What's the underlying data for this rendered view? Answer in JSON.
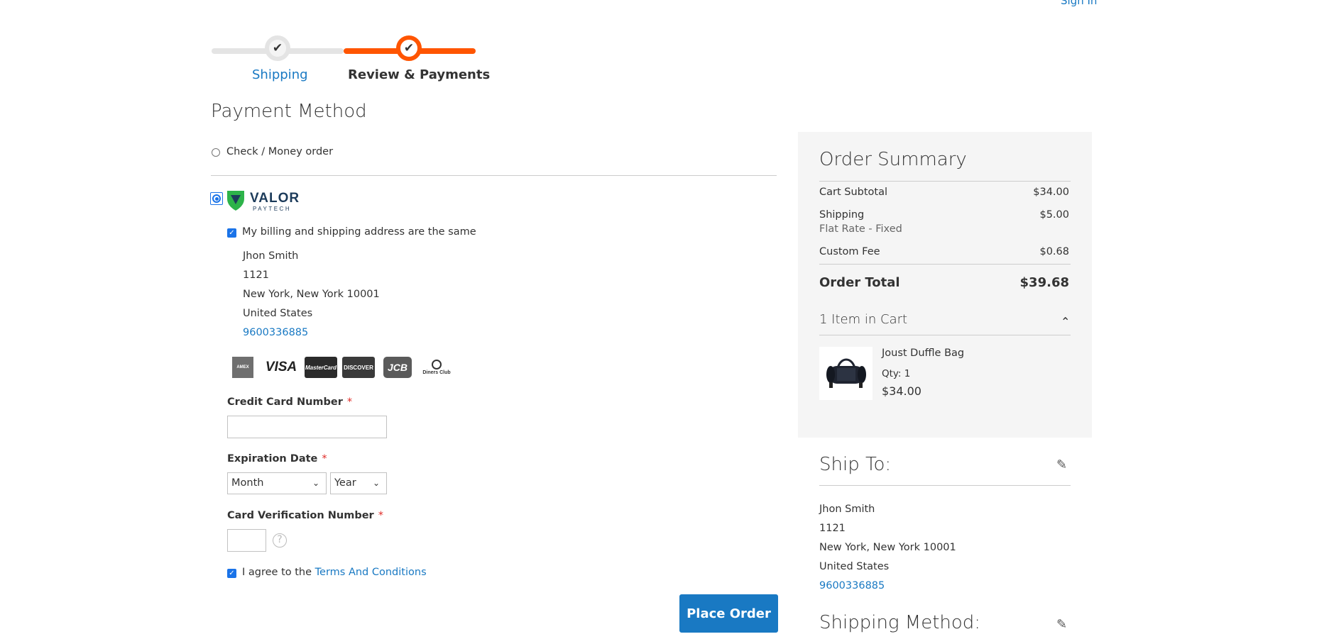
{
  "header": {
    "sign_in": "Sign In"
  },
  "progress": {
    "steps": [
      {
        "label": "Shipping",
        "state": "complete"
      },
      {
        "label": "Review & Payments",
        "state": "active"
      }
    ],
    "check_glyph": "✔"
  },
  "payment": {
    "title": "Payment Method",
    "methods": [
      {
        "label": "Check / Money order",
        "selected": false
      },
      {
        "label": "Valor PayTech",
        "selected": true
      }
    ],
    "valor_logo": {
      "word": "VALOR",
      "sub": "PAYTECH",
      "colors": {
        "green": "#2db34a",
        "navy": "#1c3b5a"
      }
    },
    "billing_same_label": "My billing and shipping address are the same",
    "address": {
      "name": "Jhon Smith",
      "street": "1121",
      "city": "New York, New York 10001",
      "country": "United States",
      "phone": "9600336885"
    },
    "cards": [
      "AMEX",
      "VISA",
      "MasterCard",
      "DISCOVER",
      "JCB",
      "Diners Club"
    ],
    "cc_number": {
      "label": "Credit Card Number",
      "required": "*",
      "value": ""
    },
    "expiration": {
      "label": "Expiration Date",
      "required": "*",
      "month": "Month",
      "year": "Year"
    },
    "cvv": {
      "label": "Card Verification Number",
      "required": "*",
      "help": "?"
    },
    "terms": {
      "prefix": "I agree to the ",
      "link": "Terms And Conditions",
      "checked": true
    },
    "place_order": "Place Order"
  },
  "summary": {
    "title": "Order Summary",
    "rows": [
      {
        "label": "Cart Subtotal",
        "value": "$34.00"
      },
      {
        "label": "Shipping",
        "sub": "Flat Rate - Fixed",
        "value": "$5.00"
      },
      {
        "label": "Custom Fee",
        "value": "$0.68"
      }
    ],
    "total": {
      "label": "Order Total",
      "value": "$39.68"
    },
    "items_heading": "1 Item in Cart",
    "item": {
      "name": "Joust Duffle Bag",
      "qty": "Qty: 1",
      "price": "$34.00"
    }
  },
  "ship_to": {
    "title": "Ship To:",
    "name": "Jhon Smith",
    "street": "1121",
    "city": "New York, New York 10001",
    "country": "United States",
    "phone": "9600336885"
  },
  "shipping_method": {
    "title": "Shipping Method:"
  },
  "icons": {
    "pencil": "✎",
    "chevron_up": "⌃",
    "chevron_down": "⌄"
  },
  "colors": {
    "accent": "#ff5501",
    "link": "#1979c3",
    "button": "#1979c3",
    "summary_bg": "#f5f5f5"
  }
}
